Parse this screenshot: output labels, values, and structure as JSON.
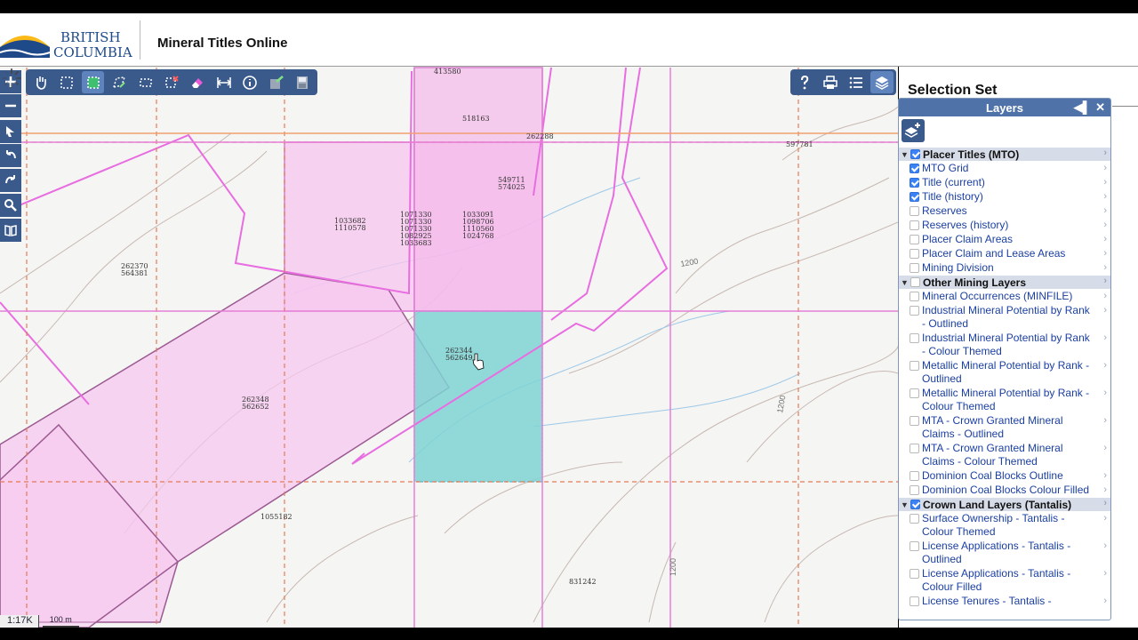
{
  "header": {
    "logo_line1": "BRITISH",
    "logo_line2": "COLUMBIA",
    "app_title": "Mineral Titles Online"
  },
  "map": {
    "scale_ratio": "1:17K",
    "scale_bar": "100 m",
    "parcel_labels": [
      {
        "id": "p1",
        "lines": [
          "413580"
        ]
      },
      {
        "id": "p2",
        "lines": [
          "518163"
        ]
      },
      {
        "id": "p3",
        "lines": [
          "262288"
        ]
      },
      {
        "id": "p4",
        "lines": [
          "597781"
        ]
      },
      {
        "id": "p5",
        "lines": [
          "549711",
          "574025"
        ]
      },
      {
        "id": "p6",
        "lines": [
          "1033682",
          "1110578"
        ]
      },
      {
        "id": "p7",
        "lines": [
          "1071330",
          "1071330",
          "1071330",
          "1082925",
          "1033683"
        ]
      },
      {
        "id": "p8",
        "lines": [
          "1033091",
          "1098706",
          "1110560",
          "1024768"
        ]
      },
      {
        "id": "p9",
        "lines": [
          "262370",
          "564381"
        ]
      },
      {
        "id": "p10",
        "lines": [
          "262344",
          "562649"
        ]
      },
      {
        "id": "p11",
        "lines": [
          "262348",
          "562652"
        ]
      },
      {
        "id": "p12",
        "lines": [
          "1055182"
        ]
      },
      {
        "id": "p13",
        "lines": [
          "831242"
        ]
      }
    ],
    "contour_labels": [
      "1200",
      "1200",
      "1200"
    ]
  },
  "toolbar": {
    "left_tools": [
      "zoom-in",
      "zoom-out",
      "select",
      "undo",
      "redo",
      "search",
      "map-book"
    ],
    "main_tools": [
      "pan",
      "select-box",
      "select-active",
      "select-polygon",
      "select-line",
      "clear-selection",
      "eraser",
      "measure",
      "info",
      "edit-layer",
      "save"
    ],
    "right_tools": [
      "help",
      "print",
      "legend",
      "layers"
    ]
  },
  "sidebar": {
    "selection_title": "Selection Set"
  },
  "layers_panel": {
    "title": "Layers",
    "groups": [
      {
        "label": "Placer Titles (MTO)",
        "checked": true,
        "items": [
          {
            "label": "MTO Grid",
            "checked": true
          },
          {
            "label": "Title (current)",
            "checked": true
          },
          {
            "label": "Title (history)",
            "checked": true
          },
          {
            "label": "Reserves",
            "checked": false
          },
          {
            "label": "Reserves (history)",
            "checked": false
          },
          {
            "label": "Placer Claim Areas",
            "checked": false
          },
          {
            "label": "Placer Claim and Lease Areas",
            "checked": false
          },
          {
            "label": "Mining Division",
            "checked": false
          }
        ]
      },
      {
        "label": "Other Mining Layers",
        "checked": false,
        "items": [
          {
            "label": "Mineral Occurrences (MINFILE)",
            "checked": false
          },
          {
            "label": "Industrial Mineral Potential by Rank - Outlined",
            "checked": false
          },
          {
            "label": "Industrial Mineral Potential by Rank - Colour Themed",
            "checked": false
          },
          {
            "label": "Metallic Mineral Potential by Rank - Outlined",
            "checked": false
          },
          {
            "label": "Metallic Mineral Potential by Rank - Colour Themed",
            "checked": false
          },
          {
            "label": "MTA - Crown Granted Mineral Claims - Outlined",
            "checked": false
          },
          {
            "label": "MTA - Crown Granted Mineral Claims - Colour Themed",
            "checked": false
          },
          {
            "label": "Dominion Coal Blocks Outline",
            "checked": false
          },
          {
            "label": "Dominion Coal Blocks Colour Filled",
            "checked": false
          }
        ]
      },
      {
        "label": "Crown Land Layers (Tantalis)",
        "checked": true,
        "items": [
          {
            "label": "Surface Ownership - Tantalis - Colour Themed",
            "checked": false
          },
          {
            "label": "License Applications - Tantalis - Outlined",
            "checked": false
          },
          {
            "label": "License Applications - Tantalis - Colour Filled",
            "checked": false
          },
          {
            "label": "License Tenures - Tantalis -",
            "checked": false
          }
        ]
      }
    ]
  },
  "colors": {
    "toolbar_bg": "#3a5a8c",
    "panel_header": "#4f73a8",
    "selected_parcel": "#7fd4d4",
    "claim_fill": "#f7c6ef",
    "claim_outline": "#e86de0"
  }
}
